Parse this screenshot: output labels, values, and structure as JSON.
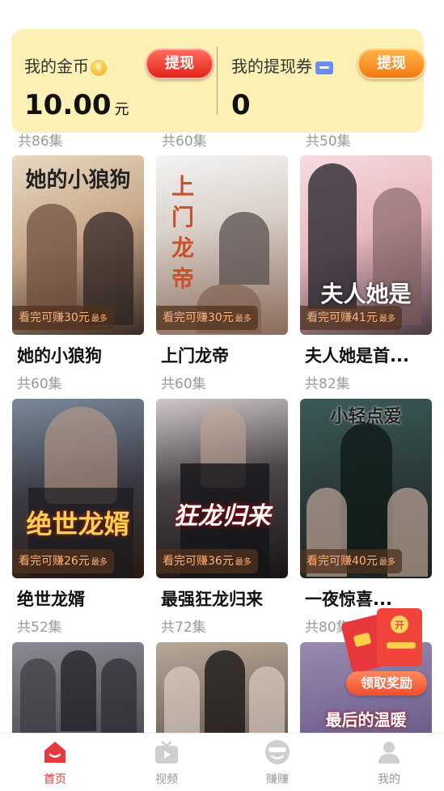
{
  "coins": {
    "gold_label": "我的金币",
    "gold_withdraw": "提现",
    "gold_value": "10.00",
    "gold_unit": "元",
    "voucher_label": "我的提现券",
    "voucher_withdraw": "提现",
    "voucher_value": "0"
  },
  "top_row_episodes": [
    "共86集",
    "共60集",
    "共50集"
  ],
  "dramas": [
    {
      "title": "她的小狼狗",
      "poster_text": "她的小狼狗",
      "episodes": "共60集",
      "earn": "看完可赚30元",
      "earn_suffix": "最多"
    },
    {
      "title": "上门龙帝",
      "poster_text": "上门 龙帝",
      "episodes": "共60集",
      "earn": "看完可赚30元",
      "earn_suffix": "最多"
    },
    {
      "title": "夫人她是首...",
      "poster_text": "夫人她是",
      "episodes": "共82集",
      "earn": "看完可赚41元",
      "earn_suffix": "最多"
    },
    {
      "title": "绝世龙婿",
      "poster_text": "绝世龙婿",
      "episodes": "共52集",
      "earn": "看完可赚26元",
      "earn_suffix": "最多"
    },
    {
      "title": "最强狂龙归来",
      "poster_text": "狂龙归来",
      "episodes": "共72集",
      "earn": "看完可赚36元",
      "earn_suffix": "最多"
    },
    {
      "title": "一夜惊喜...",
      "poster_text": "小轻点爱",
      "episodes": "共80集",
      "earn": "看完可赚40元",
      "earn_suffix": "最多"
    },
    {
      "title": "",
      "poster_text": "",
      "episodes": "",
      "earn": "",
      "earn_suffix": ""
    },
    {
      "title": "",
      "poster_text": "",
      "episodes": "",
      "earn": "",
      "earn_suffix": ""
    },
    {
      "title": "",
      "poster_text": "最后的温暖",
      "episodes": "",
      "earn": "",
      "earn_suffix": ""
    }
  ],
  "reward": {
    "label": "领取奖励",
    "badge": "开"
  },
  "nav": [
    {
      "label": "首页",
      "icon": "home-icon",
      "active": true
    },
    {
      "label": "视频",
      "icon": "video-icon",
      "active": false
    },
    {
      "label": "赚赚",
      "icon": "earn-icon",
      "active": false
    },
    {
      "label": "我的",
      "icon": "profile-icon",
      "active": false
    }
  ],
  "colors": {
    "accent": "#e8383d",
    "panel_bg": "#fdf0b4",
    "tag_text": "#ffb27a"
  }
}
